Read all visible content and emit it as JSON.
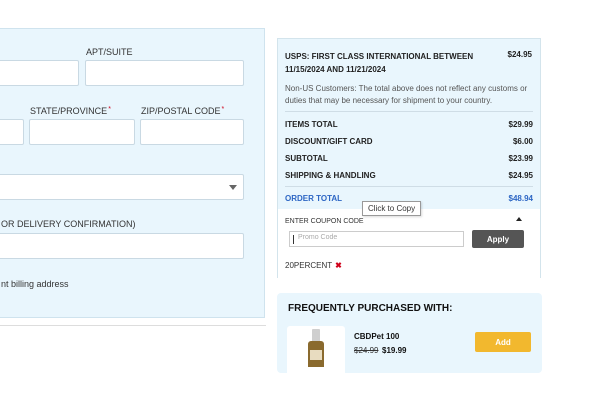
{
  "address_form": {
    "apt_label": "APT/SUITE",
    "state_label": "STATE/PROVINCE",
    "zip_label": "ZIP/POSTAL CODE",
    "required_mark": "*",
    "phone_label": "OR DELIVERY CONFIRMATION)",
    "billing_note": "nt billing address"
  },
  "order_summary": {
    "shipping_method": "USPS: FIRST CLASS INTERNATIONAL BETWEEN 11/15/2024 AND 11/21/2024",
    "shipping_method_price": "$24.95",
    "disclaimer": "Non-US Customers: The total above does not reflect any customs or duties that may be necessary for shipment to your country.",
    "rows": [
      {
        "label": "ITEMS TOTAL",
        "value": "$29.99"
      },
      {
        "label": "DISCOUNT/GIFT CARD",
        "value": "$6.00"
      },
      {
        "label": "SUBTOTAL",
        "value": "$23.99"
      },
      {
        "label": "SHIPPING & HANDLING",
        "value": "$24.95"
      }
    ],
    "order_total_label": "ORDER TOTAL",
    "order_total_value": "$48.94",
    "coupon_label": "ENTER COUPON CODE",
    "promo_placeholder": "Promo Code",
    "apply_label": "Apply",
    "applied_code": "20PERCENT",
    "remove_glyph": "✖"
  },
  "tooltip": "Click to Copy",
  "frequently_purchased": {
    "title": "FREQUENTLY PURCHASED WITH:",
    "product_name": "CBDPet 100",
    "old_price": "$24.99",
    "new_price": "$19.99",
    "add_label": "Add"
  },
  "colors": {
    "panel_bg": "#e9f6fd",
    "accent_blue": "#2d66c4",
    "add_button": "#f2b82e",
    "apply_button": "#555555",
    "remove_red": "#d0021b"
  }
}
